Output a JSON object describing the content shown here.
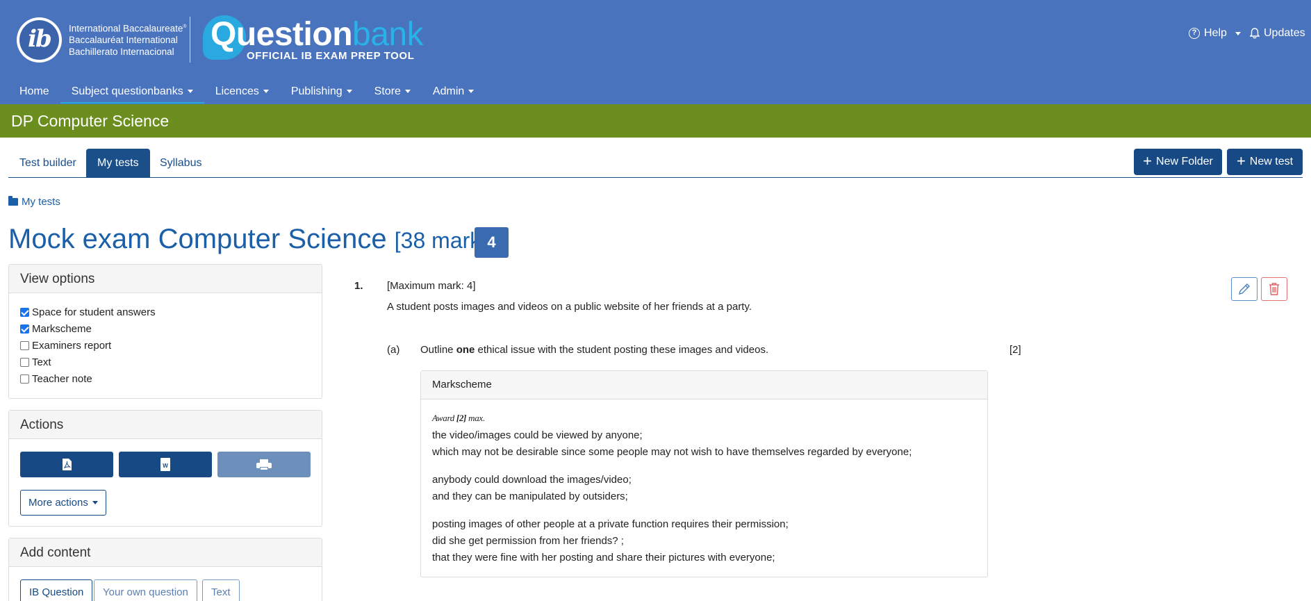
{
  "header": {
    "ib_logo_letters": "ib",
    "ib_org_lines": [
      "International Baccalaureate",
      "Baccalauréat International",
      "Bachillerato Internacional"
    ],
    "ib_registered": "®",
    "brand_name_primary": "Question",
    "brand_name_secondary": "bank",
    "brand_tagline": "OFFICIAL IB EXAM PREP TOOL",
    "help_label": "Help",
    "updates_label": "Updates",
    "colors": {
      "header_bg": "#4a73bd",
      "brand_accent": "#29b2e8"
    }
  },
  "nav": {
    "items": [
      {
        "label": "Home",
        "has_dropdown": false,
        "active": false
      },
      {
        "label": "Subject questionbanks",
        "has_dropdown": true,
        "active": true
      },
      {
        "label": "Licences",
        "has_dropdown": true,
        "active": false
      },
      {
        "label": "Publishing",
        "has_dropdown": true,
        "active": false
      },
      {
        "label": "Store",
        "has_dropdown": true,
        "active": false
      },
      {
        "label": "Admin",
        "has_dropdown": true,
        "active": false
      }
    ]
  },
  "subject": {
    "title": "DP Computer Science",
    "color": "#6b8e1e"
  },
  "tabs": {
    "items": [
      {
        "label": "Test builder",
        "active": false
      },
      {
        "label": "My tests",
        "active": true
      },
      {
        "label": "Syllabus",
        "active": false
      }
    ],
    "new_folder_label": "New Folder",
    "new_test_label": "New test"
  },
  "breadcrumb": {
    "label": "My tests"
  },
  "page": {
    "title": "Mock exam Computer Science",
    "marks": "[38 marks]",
    "badge": "4"
  },
  "view_options": {
    "heading": "View options",
    "items": [
      {
        "label": "Space for student answers",
        "checked": true
      },
      {
        "label": "Markscheme",
        "checked": true
      },
      {
        "label": "Examiners report",
        "checked": false
      },
      {
        "label": "Text",
        "checked": false
      },
      {
        "label": "Teacher note",
        "checked": false
      }
    ]
  },
  "actions": {
    "heading": "Actions",
    "pdf_icon": "pdf-icon",
    "word_icon": "word-icon",
    "word_icon_letter": "W",
    "print_icon": "printer-icon",
    "more_label": "More actions"
  },
  "add_content": {
    "heading": "Add content",
    "tabs": [
      {
        "label": "IB Question",
        "active": true
      },
      {
        "label": "Your own question",
        "active": false
      },
      {
        "label": "Text",
        "active": false
      }
    ]
  },
  "question": {
    "number": "1.",
    "max_mark": "[Maximum mark: 4]",
    "stem": "A student posts images and videos on a public website of her friends at a party.",
    "parts": [
      {
        "label": "(a)",
        "text_before": "Outline ",
        "text_emphasis": "one",
        "text_after": " ethical issue with the student posting these images and videos.",
        "marks": "[2]",
        "markscheme": {
          "heading": "Markscheme",
          "award_prefix": "Award ",
          "award_value": "[2]",
          "award_suffix": " max.",
          "groups": [
            [
              "the video/images could be viewed by anyone;",
              "which may not be desirable since some people may not wish to have themselves regarded by everyone;"
            ],
            [
              "anybody could download the images/video;",
              "and they can be manipulated by outsiders;"
            ],
            [
              "posting images of other people at a private function requires their permission;",
              "did she get permission from her friends? ;",
              "that they were fine with her posting and share their pictures with everyone;"
            ]
          ]
        }
      }
    ]
  }
}
